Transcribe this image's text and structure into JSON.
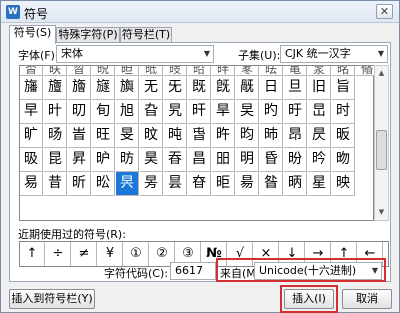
{
  "window": {
    "title": "符号",
    "app_icon_text": "W"
  },
  "tabs": [
    {
      "label": "符号(S)",
      "active": true
    },
    {
      "label": "特殊字符(P)",
      "active": false
    },
    {
      "label": "符号栏(T)",
      "active": false
    }
  ],
  "font": {
    "label": "字体(F):",
    "value": "宋体"
  },
  "subset": {
    "label": "子集(U):",
    "value": "CJK 统一汉字"
  },
  "grid": {
    "partial_row": [
      "㫘",
      "㫙",
      "㫚",
      "㫛",
      "㫜",
      "㫝",
      "㫞",
      "㫟",
      "㫠",
      "㫡",
      "㫢",
      "㫣",
      "㫤",
      "㫥",
      "㫦"
    ],
    "rows": [
      [
        "旛",
        "旜",
        "旝",
        "旞",
        "旟",
        "无",
        "旡",
        "既",
        "旣",
        "旤",
        "日",
        "旦",
        "旧",
        "旨"
      ],
      [
        "早",
        "旪",
        "旫",
        "旬",
        "旭",
        "旮",
        "旯",
        "旰",
        "旱",
        "旲",
        "旳",
        "旴",
        "旵",
        "时"
      ],
      [
        "旷",
        "旸",
        "旹",
        "旺",
        "旻",
        "旼",
        "旽",
        "旾",
        "旿",
        "昀",
        "昁",
        "昂",
        "昃",
        "昄"
      ],
      [
        "昅",
        "昆",
        "昇",
        "昈",
        "昉",
        "昊",
        "昋",
        "昌",
        "昍",
        "明",
        "昏",
        "昐",
        "昑",
        "昒"
      ],
      [
        "易",
        "昔",
        "昕",
        "昖",
        "昗",
        "昘",
        "昙",
        "昚",
        "昛",
        "昜",
        "昝",
        "昞",
        "星",
        "映"
      ]
    ],
    "selected_row": 4,
    "selected_col": 4
  },
  "recent": {
    "label": "近期使用过的符号(R):",
    "symbols": [
      "↑",
      "÷",
      "≠",
      "¥",
      "①",
      "②",
      "③",
      "№",
      "√",
      "×",
      "↓",
      "→",
      "↑",
      "←"
    ]
  },
  "char_code": {
    "label": "字符代码(C):",
    "value": "6617"
  },
  "from": {
    "label": "来自(M)",
    "value": "Unicode(十六进制)"
  },
  "buttons": {
    "insert_to_bar": "插入到符号栏(Y)",
    "insert": "插入(I)",
    "cancel": "取消"
  },
  "colors": {
    "selection": "#1c78d8",
    "highlight": "#d23030"
  }
}
